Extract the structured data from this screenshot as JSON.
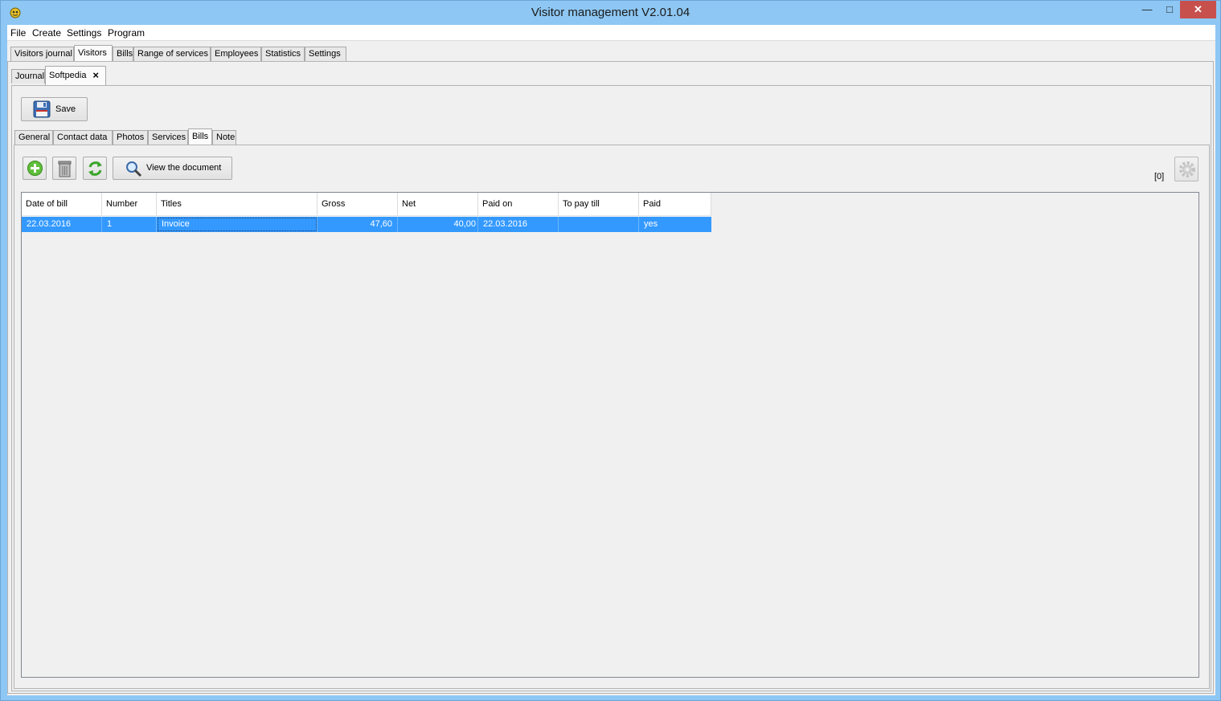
{
  "window": {
    "title": "Visitor management V2.01.04"
  },
  "menu": [
    "File",
    "Create",
    "Settings",
    "Program"
  ],
  "main_tabs": [
    "Visitors journal",
    "Visitors",
    "Bills",
    "Range of services",
    "Employees",
    "Statistics",
    "Settings"
  ],
  "sub_tabs": {
    "journal": "Journal",
    "record": "Softpedia",
    "close": "×"
  },
  "toolbar": {
    "save_label": "Save"
  },
  "detail_tabs": [
    "General",
    "Contact data",
    "Photos",
    "Services",
    "Bills",
    "Note"
  ],
  "bills": {
    "view_document_label": "View the document",
    "count_label": "[0]",
    "columns": [
      "Date of bill",
      "Number",
      "Titles",
      "Gross",
      "Net",
      "Paid on",
      "To pay till",
      "Paid"
    ],
    "rows": [
      [
        "22.03.2016",
        "1",
        "Invoice",
        "47,60",
        "40,00",
        "22.03.2016",
        "",
        "yes"
      ]
    ]
  },
  "icons": {
    "add": "add-icon",
    "delete": "trash-icon",
    "refresh": "refresh-icon",
    "search": "magnifier-icon",
    "settings": "gear-icon",
    "save": "floppy-icon"
  },
  "colors": {
    "selection": "#3399ff",
    "title_bar": "#8ec7f3",
    "close_button": "#c7504d"
  }
}
